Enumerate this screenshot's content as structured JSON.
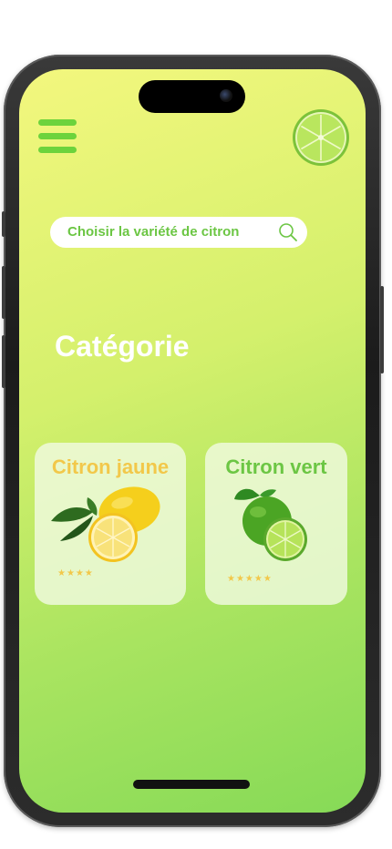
{
  "search": {
    "placeholder": "Choisir la variété de citron",
    "icon": "search-icon"
  },
  "header": {
    "menu_icon": "hamburger-menu-icon",
    "avatar_icon": "lime-slice-icon"
  },
  "section": {
    "title": "Catégorie"
  },
  "categories": [
    {
      "label": "Citron jaune",
      "color": "#f2c84a",
      "rating_text": "★★★★",
      "rating": 4,
      "icon": "yellow-lemon-icon"
    },
    {
      "label": "Citron vert",
      "color": "#6cc644",
      "rating_text": "★★★★★",
      "rating": 5,
      "icon": "green-lime-icon"
    }
  ],
  "colors": {
    "accent_green": "#6cd33c",
    "accent_yellow": "#f2c84a",
    "gradient_start": "#f3f77e",
    "gradient_end": "#86da57"
  }
}
